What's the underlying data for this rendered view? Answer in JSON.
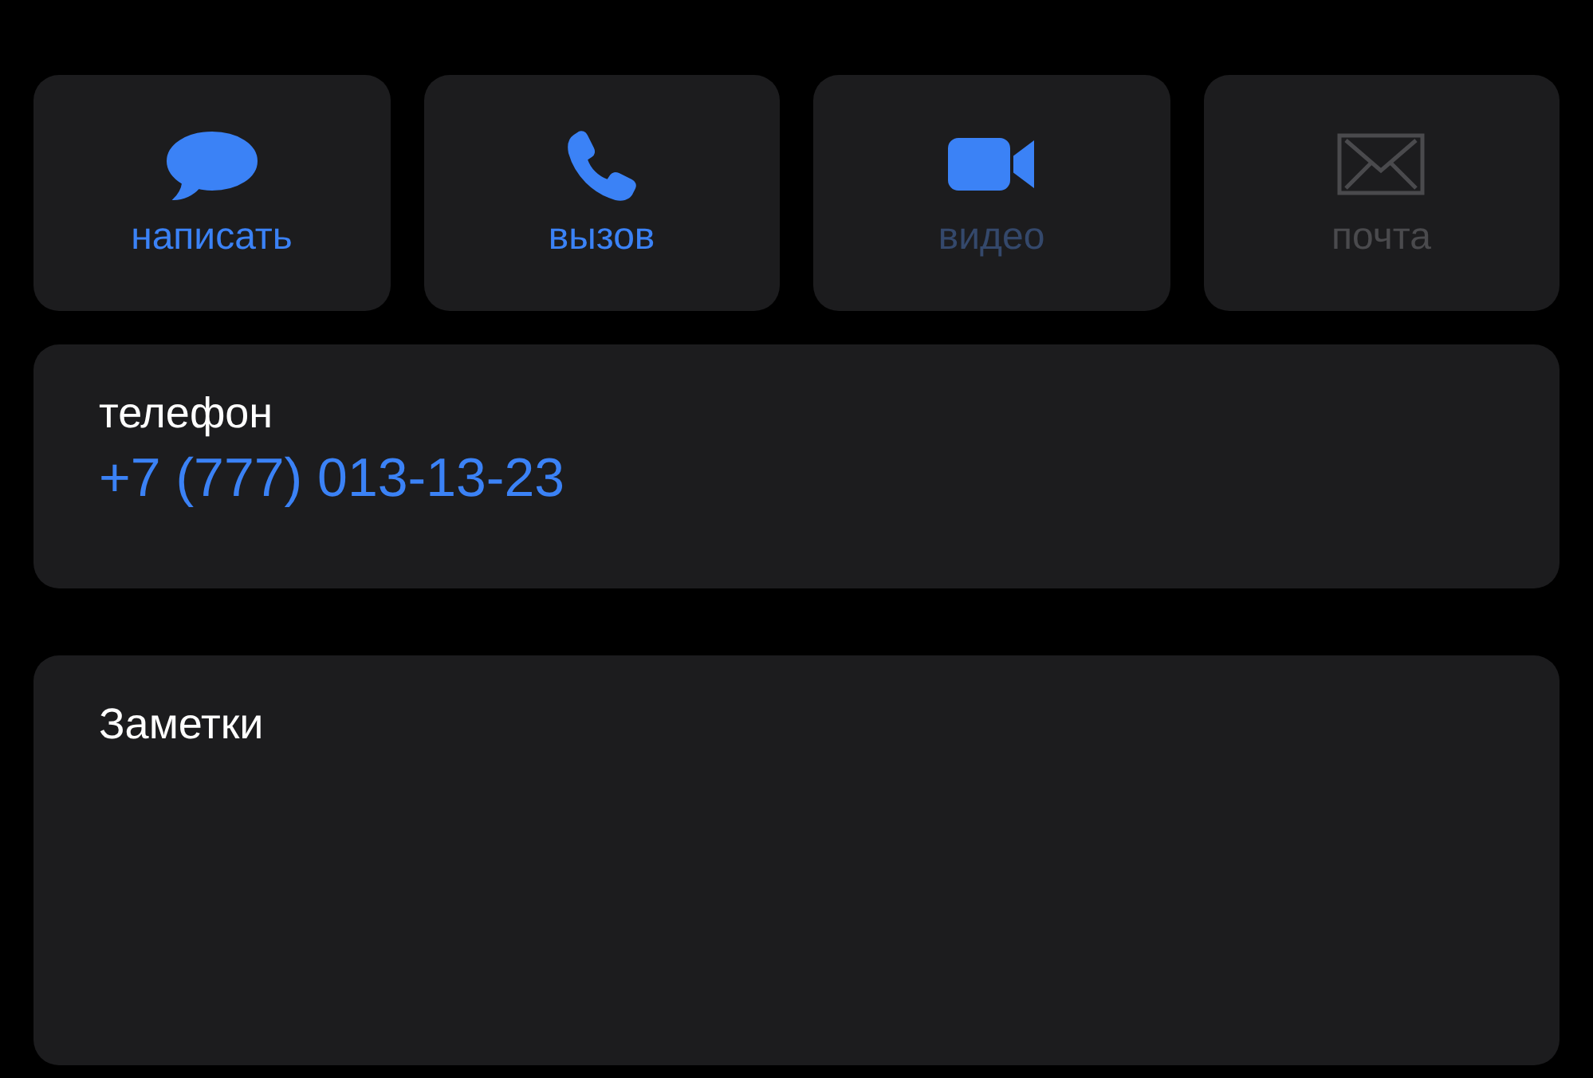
{
  "actions": [
    {
      "kind": "message",
      "label": "написать",
      "icon_active": true,
      "label_active": true
    },
    {
      "kind": "call",
      "label": "вызов",
      "icon_active": true,
      "label_active": true
    },
    {
      "kind": "video",
      "label": "видео",
      "icon_active": true,
      "label_active": false
    },
    {
      "kind": "mail",
      "label": "почта",
      "icon_active": false,
      "label_active": false
    }
  ],
  "phone": {
    "label": "телефон",
    "value": "+7 (777) 013-13-23"
  },
  "notes": {
    "label": "Заметки"
  }
}
